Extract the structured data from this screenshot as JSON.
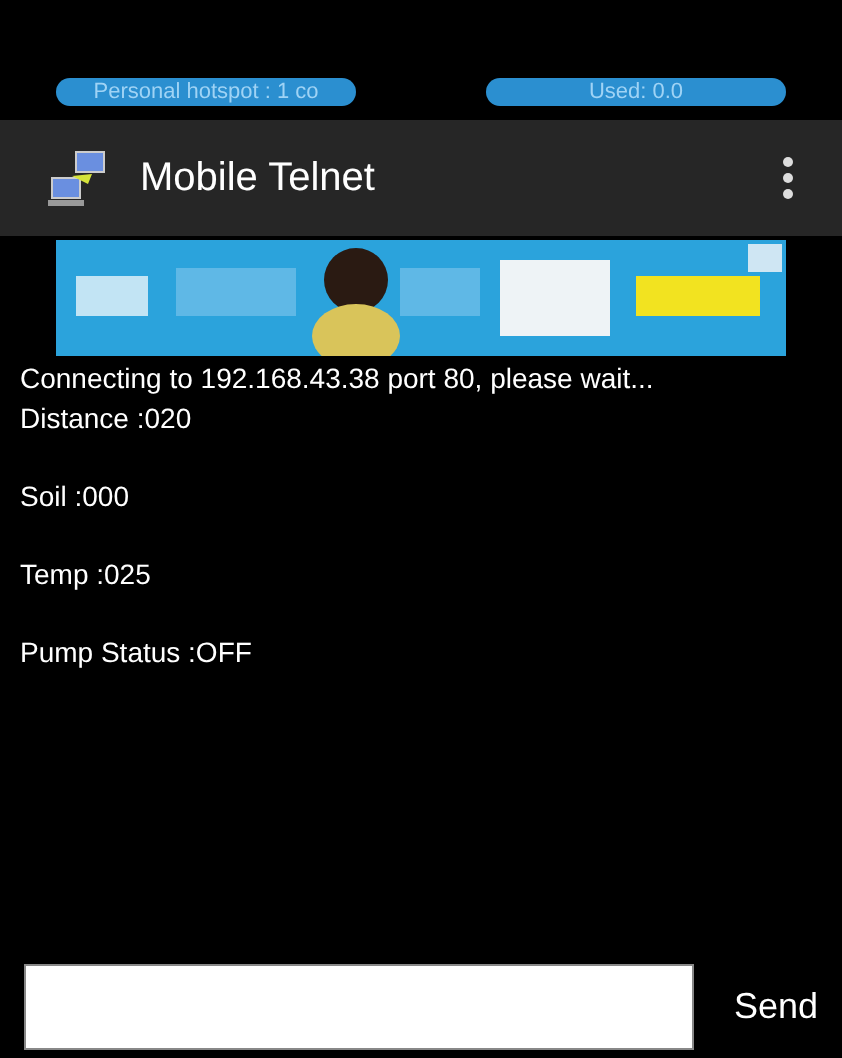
{
  "status_bar": {
    "hotspot": "Personal hotspot : 1 co",
    "used": "Used: 0.0"
  },
  "app_bar": {
    "title": "Mobile Telnet"
  },
  "output": {
    "status": "Connecting to 192.168.43.38 port 80, please wait...",
    "readings": [
      "Distance :020",
      "Soil :000",
      "Temp :025",
      "Pump Status :OFF"
    ]
  },
  "input": {
    "send_label": "Send"
  }
}
